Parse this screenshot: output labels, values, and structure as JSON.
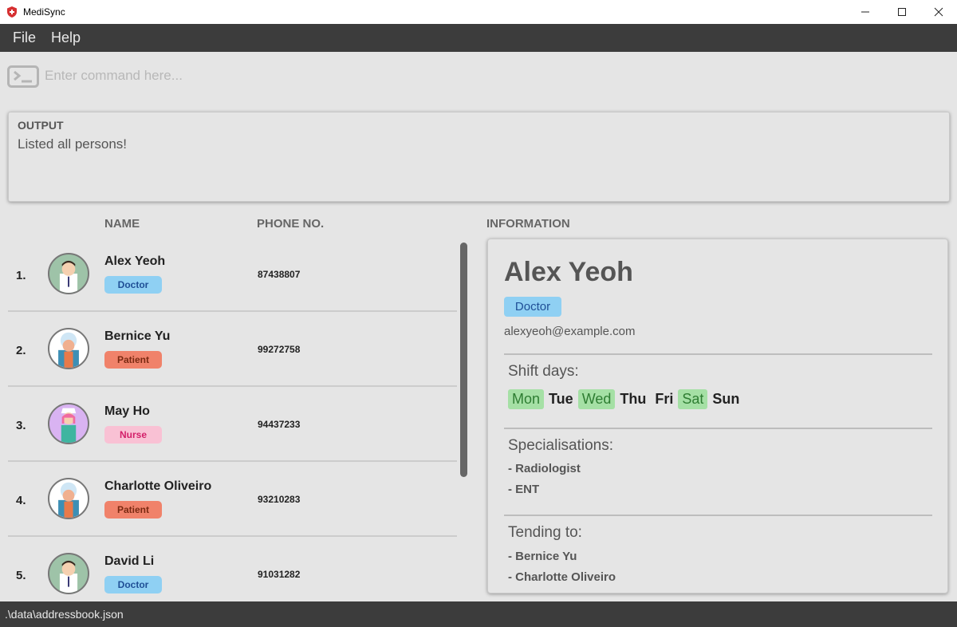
{
  "window": {
    "title": "MediSync",
    "brand_color": "#d63031"
  },
  "menu": {
    "items": [
      "File",
      "Help"
    ]
  },
  "command": {
    "placeholder": "Enter command here...",
    "value": ""
  },
  "output": {
    "label": "OUTPUT",
    "message": "Listed all persons!"
  },
  "columns": {
    "name": "NAME",
    "phone": "PHONE NO.",
    "information": "INFORMATION"
  },
  "persons": [
    {
      "index": "1.",
      "name": "Alex Yeoh",
      "role": "Doctor",
      "phone": "87438807",
      "avatar": "doctor-avatar"
    },
    {
      "index": "2.",
      "name": "Bernice Yu",
      "role": "Patient",
      "phone": "99272758",
      "avatar": "patient-avatar"
    },
    {
      "index": "3.",
      "name": "May Ho",
      "role": "Nurse",
      "phone": "94437233",
      "avatar": "nurse-avatar"
    },
    {
      "index": "4.",
      "name": "Charlotte Oliveiro",
      "role": "Patient",
      "phone": "93210283",
      "avatar": "patient-avatar"
    },
    {
      "index": "5.",
      "name": "David Li",
      "role": "Doctor",
      "phone": "91031282",
      "avatar": "doctor-avatar"
    }
  ],
  "details": {
    "name": "Alex Yeoh",
    "role": "Doctor",
    "email": "alexyeoh@example.com",
    "shift_title": "Shift days:",
    "days": [
      {
        "label": "Mon",
        "active": true
      },
      {
        "label": "Tue",
        "active": false
      },
      {
        "label": "Wed",
        "active": true
      },
      {
        "label": "Thu",
        "active": false
      },
      {
        "label": "Fri",
        "active": false
      },
      {
        "label": "Sat",
        "active": true
      },
      {
        "label": "Sun",
        "active": false
      }
    ],
    "specialisations_title": "Specialisations:",
    "specialisations": [
      "- Radiologist",
      "- ENT"
    ],
    "tending_title": "Tending to:",
    "tending": [
      "- Bernice Yu",
      "- Charlotte Oliveiro"
    ]
  },
  "status": {
    "path": ".\\data\\addressbook.json"
  }
}
